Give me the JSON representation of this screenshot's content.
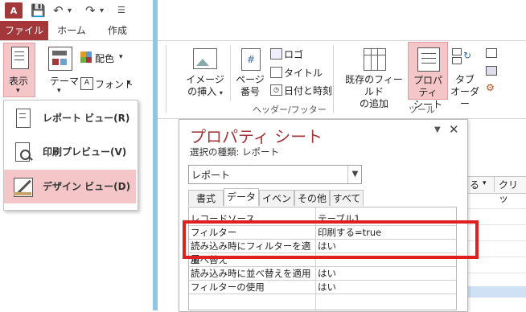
{
  "tabs": {
    "file": "ファイル",
    "home": "ホーム",
    "create": "作成"
  },
  "ribbon_left": {
    "view": "表示",
    "theme": "テーマ",
    "colors": "配色",
    "fonts": "フォント"
  },
  "view_menu": [
    {
      "label": "レポート ビュー(R)"
    },
    {
      "label": "印刷プレビュー(V)"
    },
    {
      "label": "デザイン ビュー(D)"
    }
  ],
  "ribbon_right": {
    "image_insert_1": "イメージ",
    "image_insert_2": "の挿入",
    "page_number_1": "ページ",
    "page_number_2": "番号",
    "logo": "ロゴ",
    "title": "タイトル",
    "date_time": "日付と時刻",
    "header_footer": "ヘッダー/フッター",
    "add_field_1": "既存のフィールド",
    "add_field_2": "の追加",
    "property_sheet_1": "プロパティ",
    "property_sheet_2": "シート",
    "tab_order_1": "タブ",
    "tab_order_2": "オーダー",
    "tools": "ツール"
  },
  "background": {
    "col1": "る",
    "col2": "クリッ"
  },
  "property_sheet": {
    "title": "プロパティ シート",
    "selection_type": "選択の種類: レポート",
    "selected_object": "レポート",
    "tabs": [
      "書式",
      "データ",
      "イベント",
      "その他",
      "すべて"
    ],
    "rows": [
      {
        "name": "レコードソース",
        "value": "テーブル1"
      },
      {
        "name": "フィルター",
        "value": "印刷する=true"
      },
      {
        "name": "読み込み時にフィルターを適用",
        "value": "はい"
      },
      {
        "name": "並べ替え",
        "value": ""
      },
      {
        "name": "読み込み時に並べ替えを適用",
        "value": "はい"
      },
      {
        "name": "フィルターの使用",
        "value": "はい"
      }
    ]
  },
  "colors": {
    "accent": "#a4373a",
    "highlight": "#f4c6c8",
    "redbox": "#e02020"
  }
}
